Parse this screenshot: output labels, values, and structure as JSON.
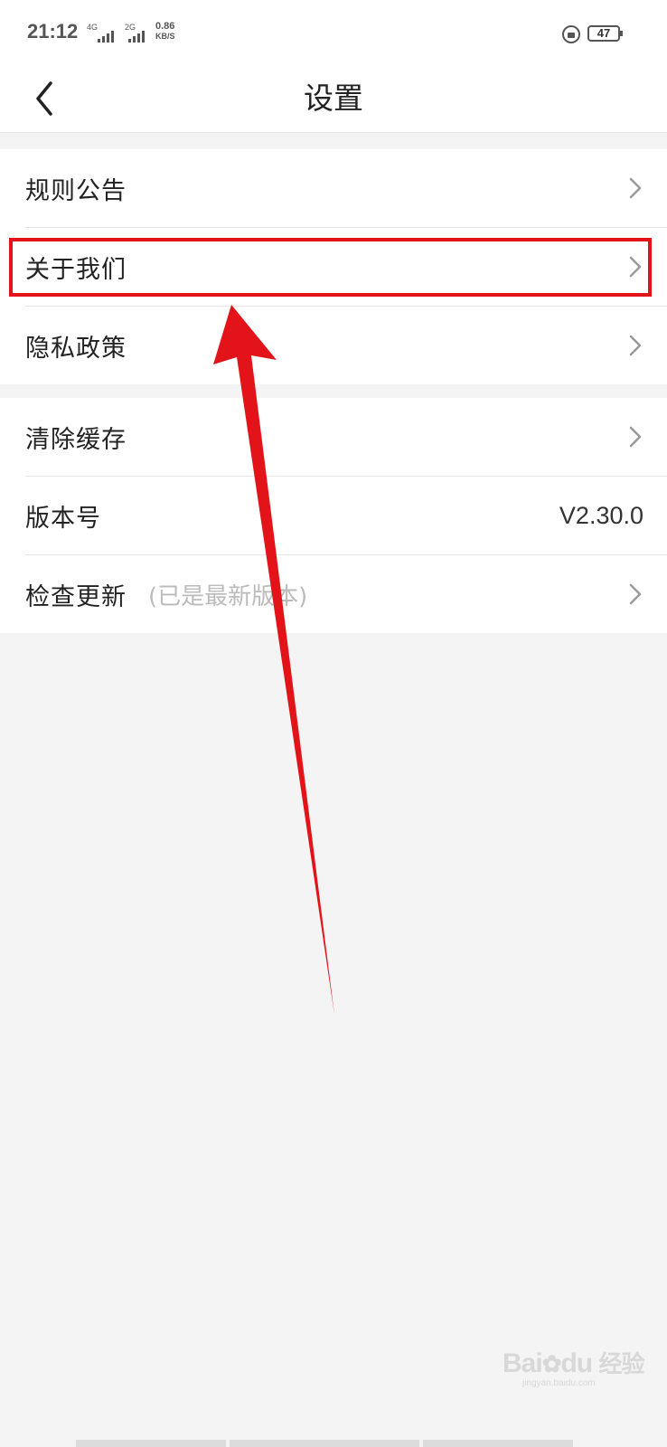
{
  "status_bar": {
    "time": "21:12",
    "sim1_label": "4G",
    "sim2_label": "2G",
    "net_speed_value": "0.86",
    "net_speed_unit": "KB/S",
    "battery": "47"
  },
  "header": {
    "title": "设置",
    "back_icon": "chevron-left-icon"
  },
  "settings": {
    "group1": [
      {
        "label": "规则公告"
      },
      {
        "label": "关于我们"
      },
      {
        "label": "隐私政策"
      }
    ],
    "group2": {
      "clear_cache": {
        "label": "清除缓存"
      },
      "version": {
        "label": "版本号",
        "value": "V2.30.0"
      },
      "check_update": {
        "label": "检查更新",
        "hint": "(已是最新版本)"
      }
    }
  },
  "annotation": {
    "highlight_color": "#e2141a",
    "arrow_color": "#e2141a",
    "highlighted_item": "关于我们"
  },
  "watermark": {
    "brand": "Bai",
    "brand2": "du",
    "suffix": "经验",
    "url": "jingyan.baidu.com"
  }
}
